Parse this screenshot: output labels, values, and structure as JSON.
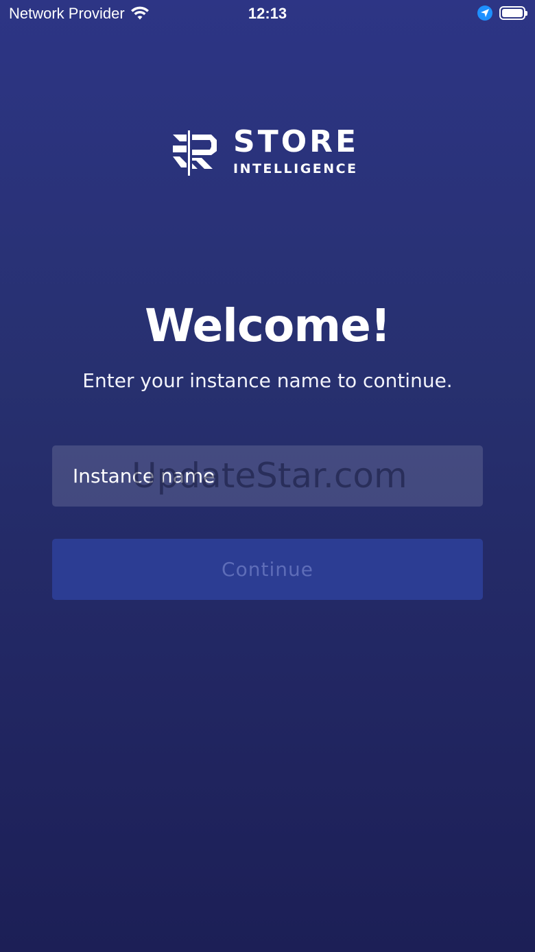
{
  "status_bar": {
    "carrier": "Network Provider",
    "time": "12:13",
    "icons": [
      "wifi-icon",
      "location-icon",
      "battery-icon"
    ]
  },
  "logo": {
    "line1": "STORE",
    "line2": "INTELLIGENCE",
    "icon": "store-intelligence-logo-icon"
  },
  "welcome": {
    "title": "Welcome!",
    "subtitle": "Enter your instance name to continue."
  },
  "form": {
    "instance_placeholder": "Instance name",
    "instance_value": "",
    "continue_label": "Continue"
  },
  "watermark": "UpdateStar.com",
  "colors": {
    "background_top": "#2d3585",
    "background_bottom": "#1c1f56",
    "button_bg": "#2c3d93",
    "button_text_disabled": "#5e6db8",
    "location_accent": "#1e90ff"
  }
}
